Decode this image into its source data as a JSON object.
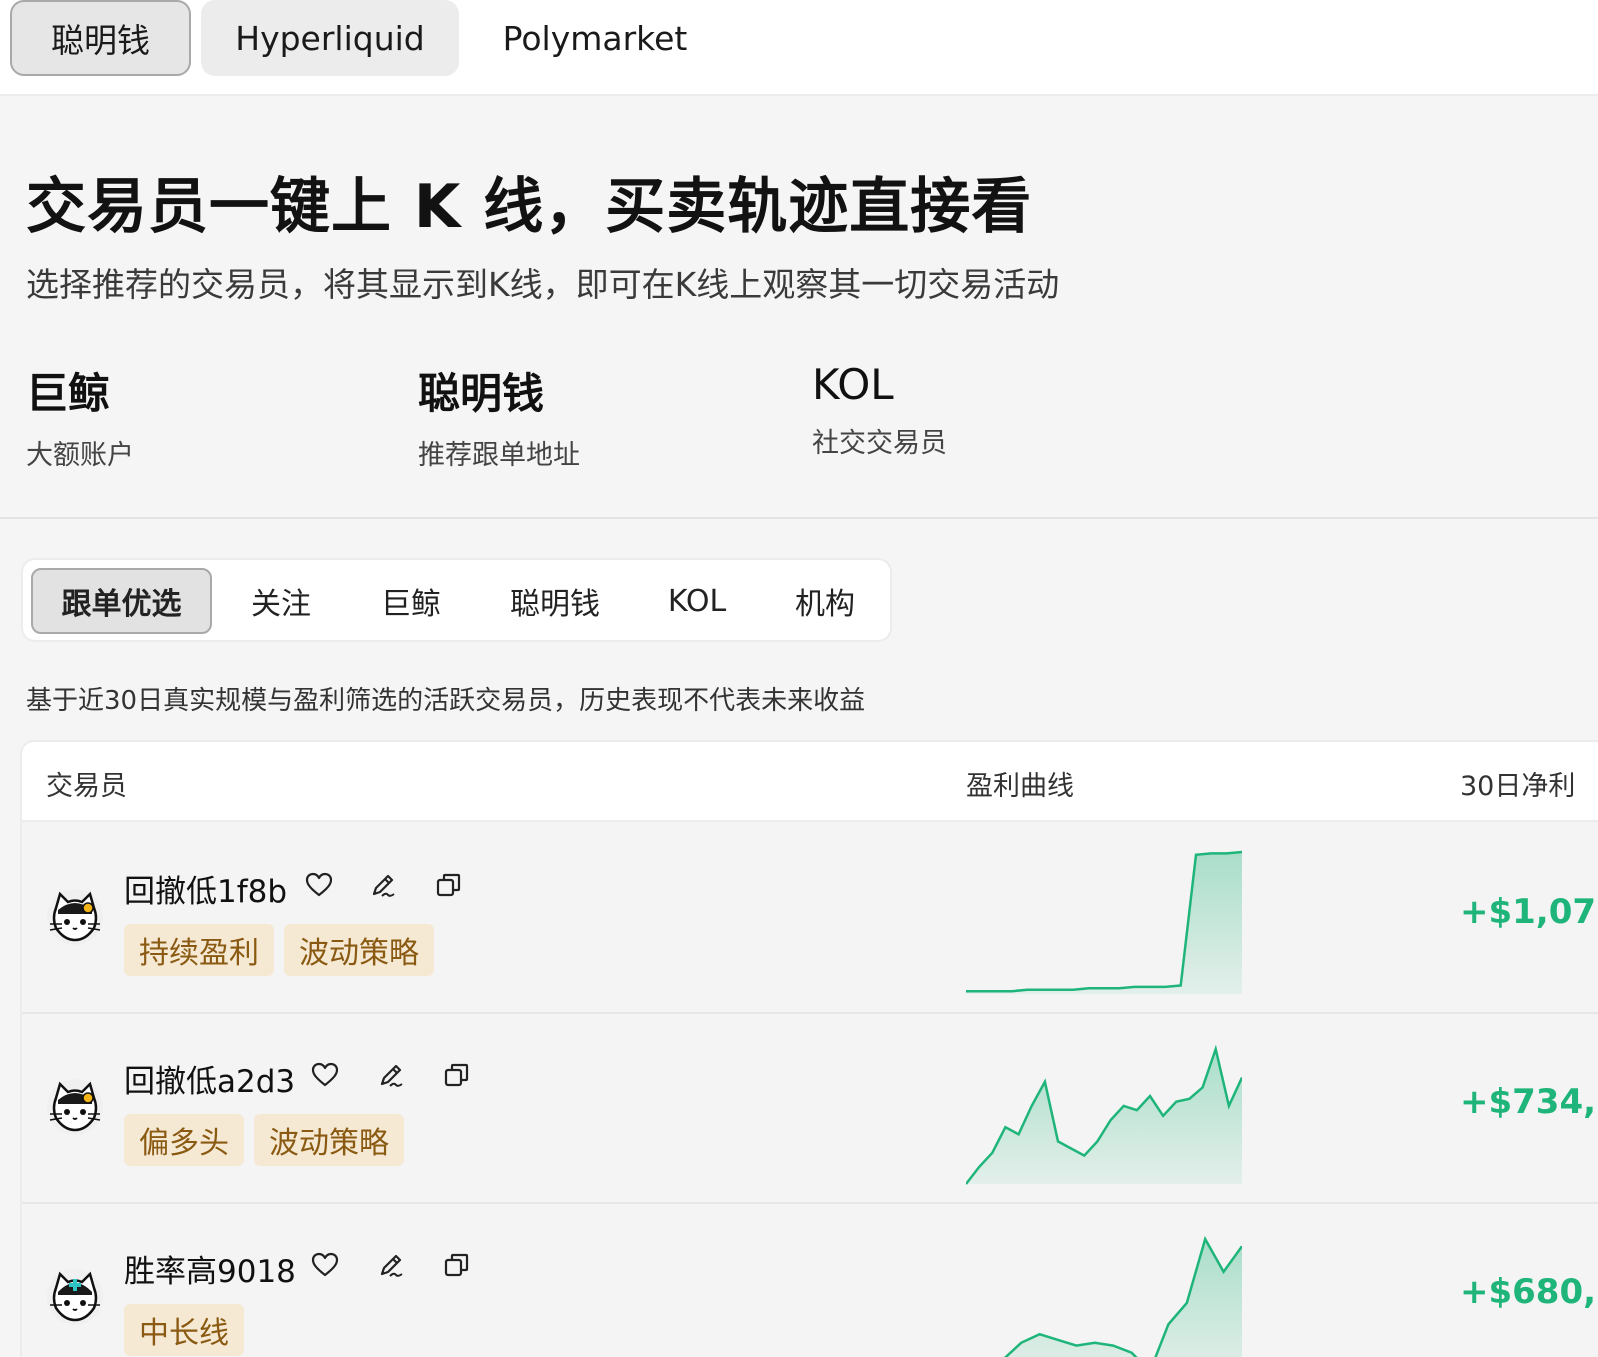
{
  "top_tabs": [
    {
      "label": "聪明钱",
      "active": true
    },
    {
      "label": "Hyperliquid",
      "active": false
    },
    {
      "label": "Polymarket",
      "active": false
    }
  ],
  "hero": {
    "title": "交易员一键上 K 线，买卖轨迹直接看",
    "subtitle": "选择推荐的交易员，将其显示到K线，即可在K线上观察其一切交易活动"
  },
  "categories": [
    {
      "title": "巨鲸",
      "subtitle": "大额账户"
    },
    {
      "title": "聪明钱",
      "subtitle": "推荐跟单地址"
    },
    {
      "title": "KOL",
      "subtitle": "社交交易员"
    }
  ],
  "filter_tabs": [
    {
      "label": "跟单优选",
      "active": true
    },
    {
      "label": "关注",
      "active": false
    },
    {
      "label": "巨鲸",
      "active": false
    },
    {
      "label": "聪明钱",
      "active": false
    },
    {
      "label": "KOL",
      "active": false
    },
    {
      "label": "机构",
      "active": false
    }
  ],
  "note": "基于近30日真实规模与盈利筛选的活跃交易员，历史表现不代表未来收益",
  "table": {
    "headers": {
      "trader": "交易员",
      "curve": "盈利曲线",
      "pnl30": "30日净利"
    },
    "rows": [
      {
        "name": "回撤低1f8b",
        "tags": [
          "持续盈利",
          "波动策略"
        ],
        "pnl": "+$1,07",
        "curve": [
          0.02,
          0.02,
          0.02,
          0.02,
          0.03,
          0.03,
          0.03,
          0.03,
          0.04,
          0.04,
          0.04,
          0.05,
          0.05,
          0.05,
          0.06,
          0.98,
          0.99,
          0.99,
          1.0
        ]
      },
      {
        "name": "回撤低a2d3",
        "tags": [
          "偏多头",
          "波动策略"
        ],
        "pnl": "+$734,",
        "curve": [
          0.0,
          0.12,
          0.22,
          0.4,
          0.35,
          0.55,
          0.72,
          0.3,
          0.25,
          0.2,
          0.3,
          0.45,
          0.55,
          0.52,
          0.62,
          0.48,
          0.58,
          0.6,
          0.68,
          0.95,
          0.55,
          0.75
        ]
      },
      {
        "name": "胜率高9018",
        "tags": [
          "中长线"
        ],
        "pnl": "+$680,",
        "curve": [
          0.0,
          0.05,
          0.1,
          0.22,
          0.28,
          0.24,
          0.2,
          0.22,
          0.2,
          0.15,
          0.02,
          0.35,
          0.5,
          0.95,
          0.72,
          0.9
        ]
      }
    ]
  },
  "colors": {
    "accent": "#1fb57a",
    "tag_bg": "#f6e9d4",
    "tag_text": "#8a5a12"
  },
  "icons": [
    "heart-icon",
    "edit-icon",
    "copy-icon",
    "cat-avatar-icon"
  ]
}
